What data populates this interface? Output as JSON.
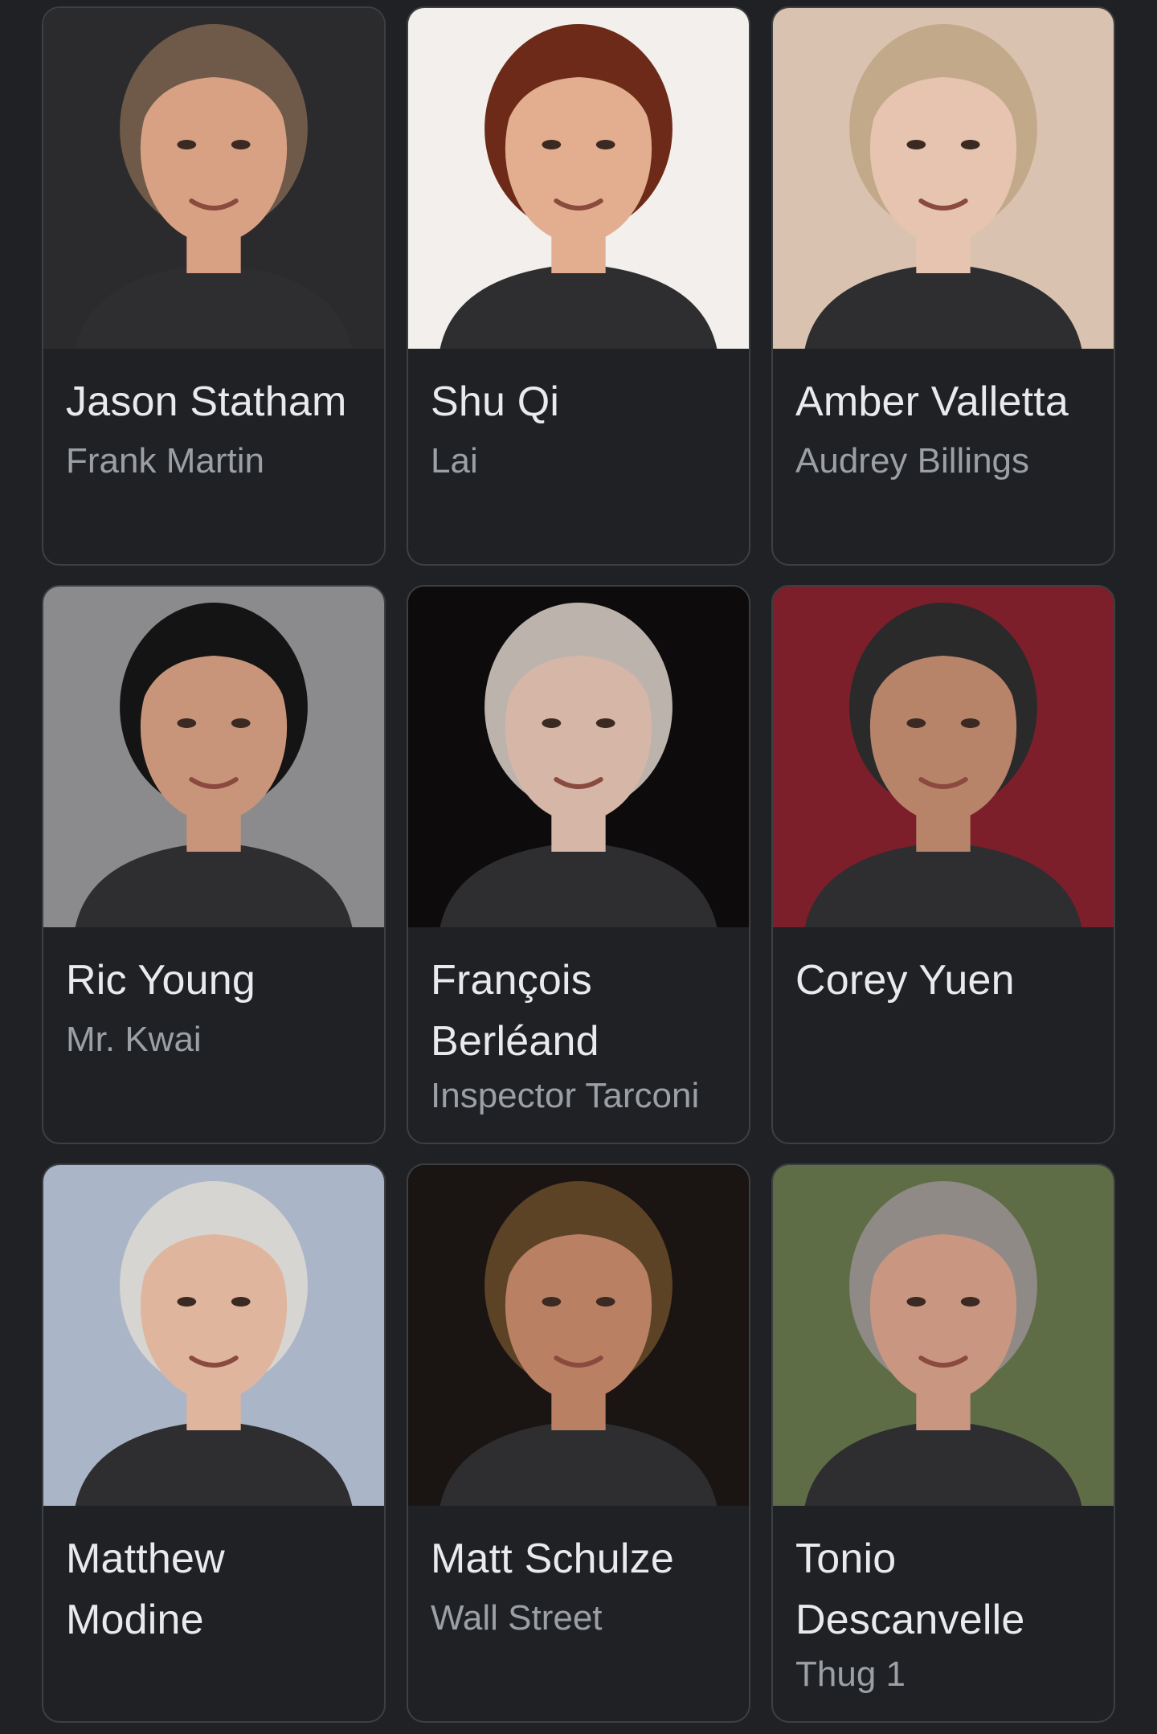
{
  "cast": [
    {
      "name": "Jason Statham",
      "role": "Frank Martin",
      "photo_icon": "person-photo",
      "bg": "#2b2b2e",
      "skin": "#d9a184",
      "hair": "#6f5a4a"
    },
    {
      "name": "Shu Qi",
      "role": "Lai",
      "photo_icon": "person-photo",
      "bg": "#f2efec",
      "skin": "#e3ae8f",
      "hair": "#6e2a18"
    },
    {
      "name": "Amber Valletta",
      "role": "Audrey Billings",
      "photo_icon": "person-photo",
      "bg": "#d9c3b0",
      "skin": "#e6c4b0",
      "hair": "#c2a98a"
    },
    {
      "name": "Ric Young",
      "role": "Mr. Kwai",
      "photo_icon": "person-photo",
      "bg": "#8b8b8d",
      "skin": "#c9957a",
      "hair": "#141414"
    },
    {
      "name": "François Berléand",
      "role": "Inspector Tarconi",
      "photo_icon": "person-photo",
      "bg": "#0d0b0b",
      "skin": "#d6b6a7",
      "hair": "#bdb3ad"
    },
    {
      "name": "Corey Yuen",
      "role": "",
      "photo_icon": "person-photo",
      "bg": "#7d1f2a",
      "skin": "#b78469",
      "hair": "#2a2a2a"
    },
    {
      "name": "Matthew Modine",
      "role": "",
      "photo_icon": "person-photo",
      "bg": "#aab6c8",
      "skin": "#e0b59d",
      "hair": "#d7d5d2"
    },
    {
      "name": "Matt Schulze",
      "role": "Wall Street",
      "photo_icon": "person-photo",
      "bg": "#1a1512",
      "skin": "#b98064",
      "hair": "#5d4326"
    },
    {
      "name": "Tonio Descanvelle",
      "role": "Thug 1",
      "photo_icon": "person-photo",
      "bg": "#5f6d47",
      "skin": "#c99682",
      "hair": "#8f8a86"
    }
  ]
}
